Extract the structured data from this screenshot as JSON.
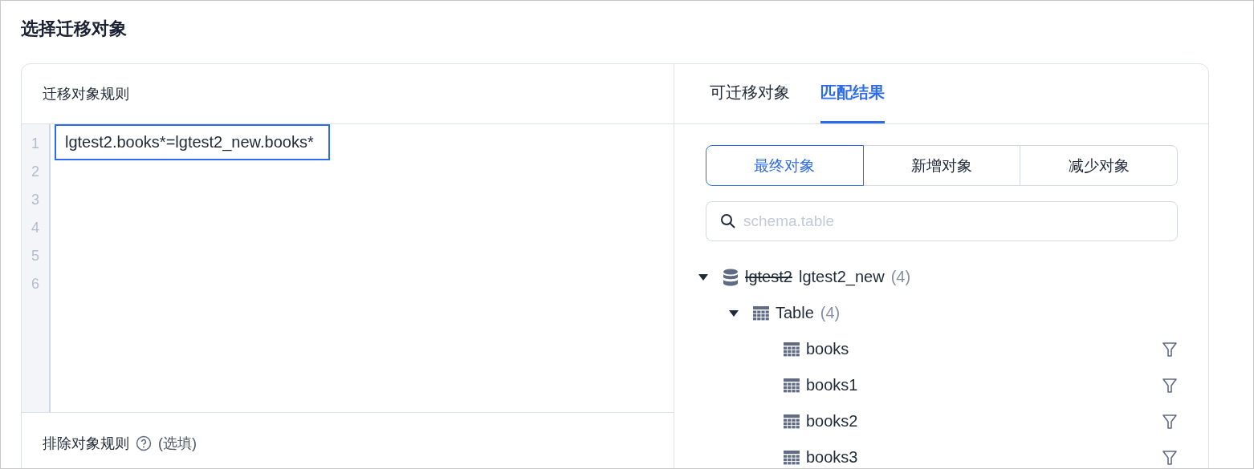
{
  "title": "选择迁移对象",
  "rules_panel": {
    "heading": "迁移对象规则",
    "line_numbers": [
      "1",
      "2",
      "3",
      "4",
      "5",
      "6"
    ],
    "code_lines": [
      "lgtest2.books*=lgtest2_new.books*"
    ],
    "exclude_label": "排除对象规则",
    "exclude_hint": "(选填)"
  },
  "tabs": [
    {
      "label": "可迁移对象",
      "selected": false
    },
    {
      "label": "匹配结果",
      "selected": true
    }
  ],
  "segments": [
    {
      "label": "最终对象",
      "selected": true
    },
    {
      "label": "新增对象",
      "selected": false
    },
    {
      "label": "减少对象",
      "selected": false
    }
  ],
  "search": {
    "placeholder": "schema.table"
  },
  "tree": [
    {
      "kind": "database",
      "old_name": "lgtest2",
      "name": "lgtest2_new",
      "count": "(4)",
      "expanded": true,
      "children": [
        {
          "kind": "group",
          "name": "Table",
          "count": "(4)",
          "expanded": true,
          "children": [
            {
              "kind": "table",
              "name": "books"
            },
            {
              "kind": "table",
              "name": "books1"
            },
            {
              "kind": "table",
              "name": "books2"
            },
            {
              "kind": "table",
              "name": "books3"
            }
          ]
        }
      ]
    }
  ]
}
